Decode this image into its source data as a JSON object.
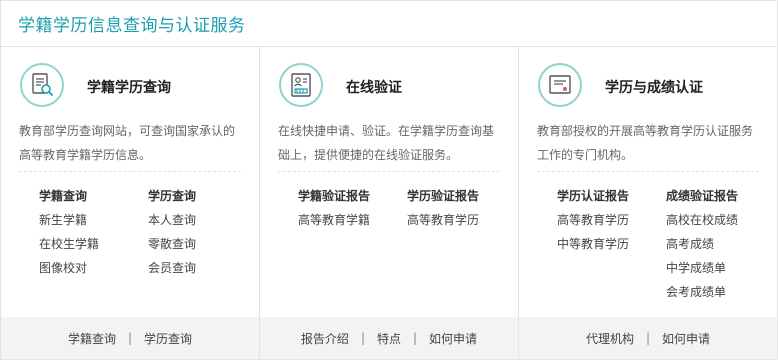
{
  "page_title": "学籍学历信息查询与认证服务",
  "columns": [
    {
      "icon": "document-search-icon",
      "title": "学籍学历查询",
      "desc": "教育部学历查询网站，可查询国家承认的高等教育学籍学历信息。",
      "lists": [
        {
          "head": "学籍查询",
          "items": [
            "新生学籍",
            "在校生学籍",
            "图像校对"
          ]
        },
        {
          "head": "学历查询",
          "items": [
            "本人查询",
            "零散查询",
            "会员查询"
          ]
        }
      ],
      "footer_links": [
        "学籍查询",
        "学历查询"
      ]
    },
    {
      "icon": "verification-report-icon",
      "title": "在线验证",
      "desc": "在线快捷申请、验证。在学籍学历查询基础上，提供便捷的在线验证服务。",
      "lists": [
        {
          "head": "学籍验证报告",
          "items": [
            "高等教育学籍"
          ]
        },
        {
          "head": "学历验证报告",
          "items": [
            "高等教育学历"
          ]
        }
      ],
      "footer_links": [
        "报告介绍",
        "特点",
        "如何申请"
      ]
    },
    {
      "icon": "certificate-icon",
      "title": "学历与成绩认证",
      "desc": "教育部授权的开展高等教育学历认证服务工作的专门机构。",
      "lists": [
        {
          "head": "学历认证报告",
          "items": [
            "高等教育学历",
            "中等教育学历"
          ]
        },
        {
          "head": "成绩验证报告",
          "items": [
            "高校在校成绩",
            "高考成绩",
            "中学成绩单",
            "会考成绩单"
          ]
        }
      ],
      "footer_links": [
        "代理机构",
        "如何申请"
      ]
    }
  ],
  "colors": {
    "accent": "#1a9fb0",
    "icon_ring": "#8fd2cf",
    "footer_bg": "#f3f3f3"
  }
}
